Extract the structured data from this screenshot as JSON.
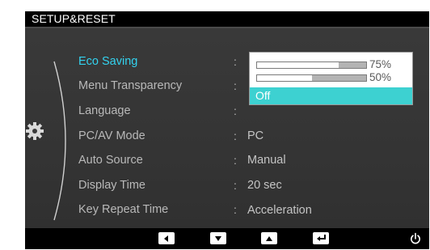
{
  "header": {
    "title": "SETUP&RESET"
  },
  "menu": {
    "items": [
      {
        "label": "Eco Saving",
        "value": ""
      },
      {
        "label": "Menu Transparency",
        "value": ""
      },
      {
        "label": "Language",
        "value": ""
      },
      {
        "label": "PC/AV Mode",
        "value": "PC"
      },
      {
        "label": "Auto Source",
        "value": "Manual"
      },
      {
        "label": "Display Time",
        "value": "20 sec"
      },
      {
        "label": "Key Repeat Time",
        "value": "Acceleration"
      }
    ],
    "colon": ":"
  },
  "eco_popup": {
    "options": [
      {
        "label": "75%",
        "level": 0.75
      },
      {
        "label": "50%",
        "level": 0.5
      },
      {
        "label": "Off"
      }
    ],
    "selected": "Off"
  },
  "colors": {
    "accent": "#33d3f0",
    "highlight": "#3dd1d1"
  },
  "footer": {
    "buttons": [
      "left-arrow-icon",
      "down-arrow-icon",
      "up-arrow-icon",
      "enter-icon",
      "power-icon"
    ]
  }
}
